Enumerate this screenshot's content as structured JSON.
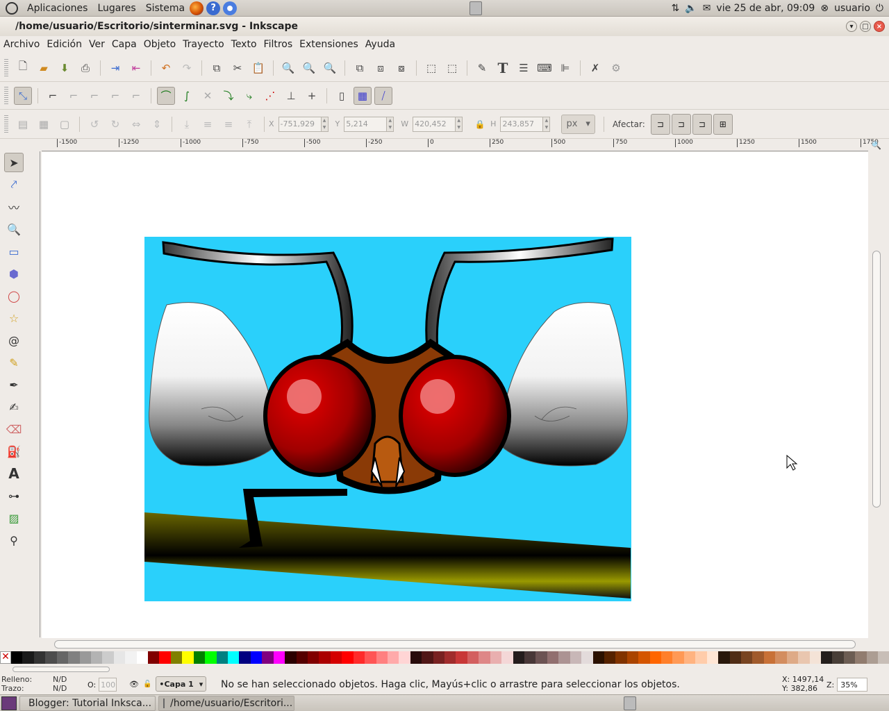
{
  "top_panel": {
    "menus": [
      "Aplicaciones",
      "Lugares",
      "Sistema"
    ],
    "datetime": "vie 25 de abr, 09:09",
    "user": "usuario"
  },
  "window": {
    "title": "/home/usuario/Escritorio/sinterminar.svg - Inkscape"
  },
  "menubar": [
    "Archivo",
    "Edición",
    "Ver",
    "Capa",
    "Objeto",
    "Trayecto",
    "Texto",
    "Filtros",
    "Extensiones",
    "Ayuda"
  ],
  "selector_bar": {
    "x_label": "X",
    "x_value": "-751,929",
    "y_label": "Y",
    "y_value": "5,214",
    "w_label": "W",
    "w_value": "420,452",
    "h_label": "H",
    "h_value": "243,857",
    "unit": "px",
    "affect_label": "Afectar:"
  },
  "ruler": {
    "ticks": [
      "-1500",
      "-1250",
      "-1000",
      "-750",
      "-500",
      "-250",
      "0",
      "250",
      "500",
      "750",
      "1000",
      "1250",
      "1500",
      "1750"
    ]
  },
  "palette": [
    "#000000",
    "#1a1a1a",
    "#333333",
    "#4d4d4d",
    "#666666",
    "#808080",
    "#999999",
    "#b3b3b3",
    "#cccccc",
    "#e6e6e6",
    "#f2f2f2",
    "#ffffff",
    "#800000",
    "#ff0000",
    "#808000",
    "#ffff00",
    "#008000",
    "#00ff00",
    "#008080",
    "#00ffff",
    "#000080",
    "#0000ff",
    "#800080",
    "#ff00ff",
    "#2b0000",
    "#550000",
    "#800000",
    "#aa0000",
    "#d40000",
    "#ff0000",
    "#ff2a2a",
    "#ff5555",
    "#ff8080",
    "#ffaaaa",
    "#ffd5d5",
    "#280b0b",
    "#501616",
    "#782121",
    "#a02c2c",
    "#c83737",
    "#d35f5f",
    "#de8787",
    "#e9afaf",
    "#f4d7d7",
    "#241c1c",
    "#483737",
    "#6c5353",
    "#916f6f",
    "#ac9393",
    "#c8b7b7",
    "#e3dbdb",
    "#2b1100",
    "#552200",
    "#803300",
    "#aa4400",
    "#d45500",
    "#ff6600",
    "#ff7f2a",
    "#ff9955",
    "#ffb380",
    "#ffccaa",
    "#ffe6d5",
    "#28170b",
    "#502d16",
    "#784421",
    "#a05a2c",
    "#c87137",
    "#d38d5f",
    "#deaa87",
    "#e9c6af",
    "#f4e3d7",
    "#241f1c",
    "#483e37",
    "#6c5d53",
    "#917c6f",
    "#ac9d93",
    "#c8beb7"
  ],
  "statusbar": {
    "fill_label": "Relleno:",
    "fill_value": "N/D",
    "stroke_label": "Trazo:",
    "stroke_value": "N/D",
    "opacity_label": "O:",
    "opacity_value": "100",
    "layer_name": "•Capa 1",
    "message": "No se han seleccionado objetos. Haga clic, Mayús+clic o arrastre para seleccionar los objetos.",
    "x_coord": "X: 1497,14",
    "y_coord": "Y:   382,86",
    "zoom_label": "Z:",
    "zoom_value": "35%"
  },
  "taskbar": [
    "Blogger: Tutorial Inksca...",
    "/home/usuario/Escritori..."
  ],
  "colors": {
    "sky": "#2ad0fb",
    "eye_red": "#c30000",
    "face_brown": "#8a3a06",
    "branch": "#6a6600"
  }
}
